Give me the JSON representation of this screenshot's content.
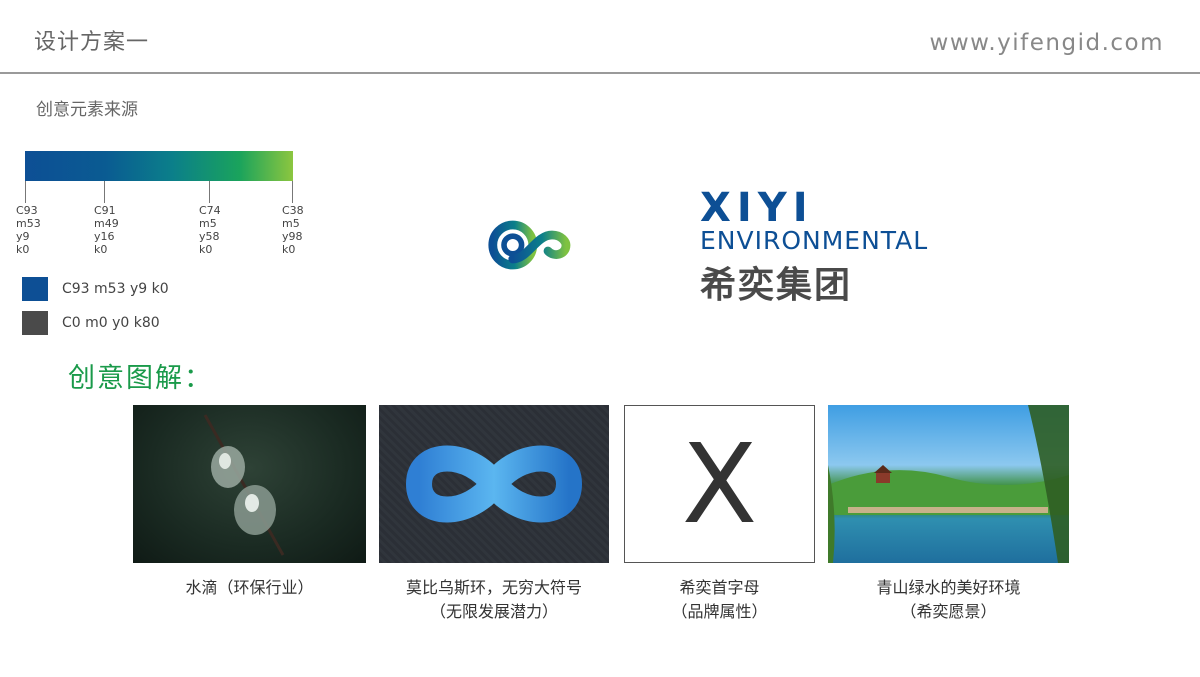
{
  "header": {
    "title": "设计方案一",
    "url": "www.yifengid.com"
  },
  "section": {
    "title": "创意元素来源"
  },
  "palette": {
    "gradient_stops": [
      {
        "c": "C93",
        "m": "m53",
        "y": "y9",
        "k": "k0"
      },
      {
        "c": "C91",
        "m": "m49",
        "y": "y16",
        "k": "k0"
      },
      {
        "c": "C74",
        "m": "m5",
        "y": "y58",
        "k": "k0"
      },
      {
        "c": "C38",
        "m": "m5",
        "y": "y98",
        "k": "k0"
      }
    ],
    "legend": [
      {
        "label": "C93 m53 y9 k0",
        "color": "#0d4f95"
      },
      {
        "label": "C0 m0 y0 k80",
        "color": "#4a4a4a"
      }
    ]
  },
  "logo": {
    "name_en_1": "XIYI",
    "name_en_2": "ENVIRONMENTAL",
    "name_cn": "希奕集团"
  },
  "explain": {
    "title": "创意图解：",
    "items": [
      {
        "line1": "水滴（环保行业）",
        "line2": ""
      },
      {
        "line1": "莫比乌斯环，无穷大符号",
        "line2": "（无限发展潜力）"
      },
      {
        "line1": "希奕首字母",
        "line2": "（品牌属性）",
        "glyph": "X"
      },
      {
        "line1": "青山绿水的美好环境",
        "line2": "（希奕愿景）"
      }
    ]
  }
}
